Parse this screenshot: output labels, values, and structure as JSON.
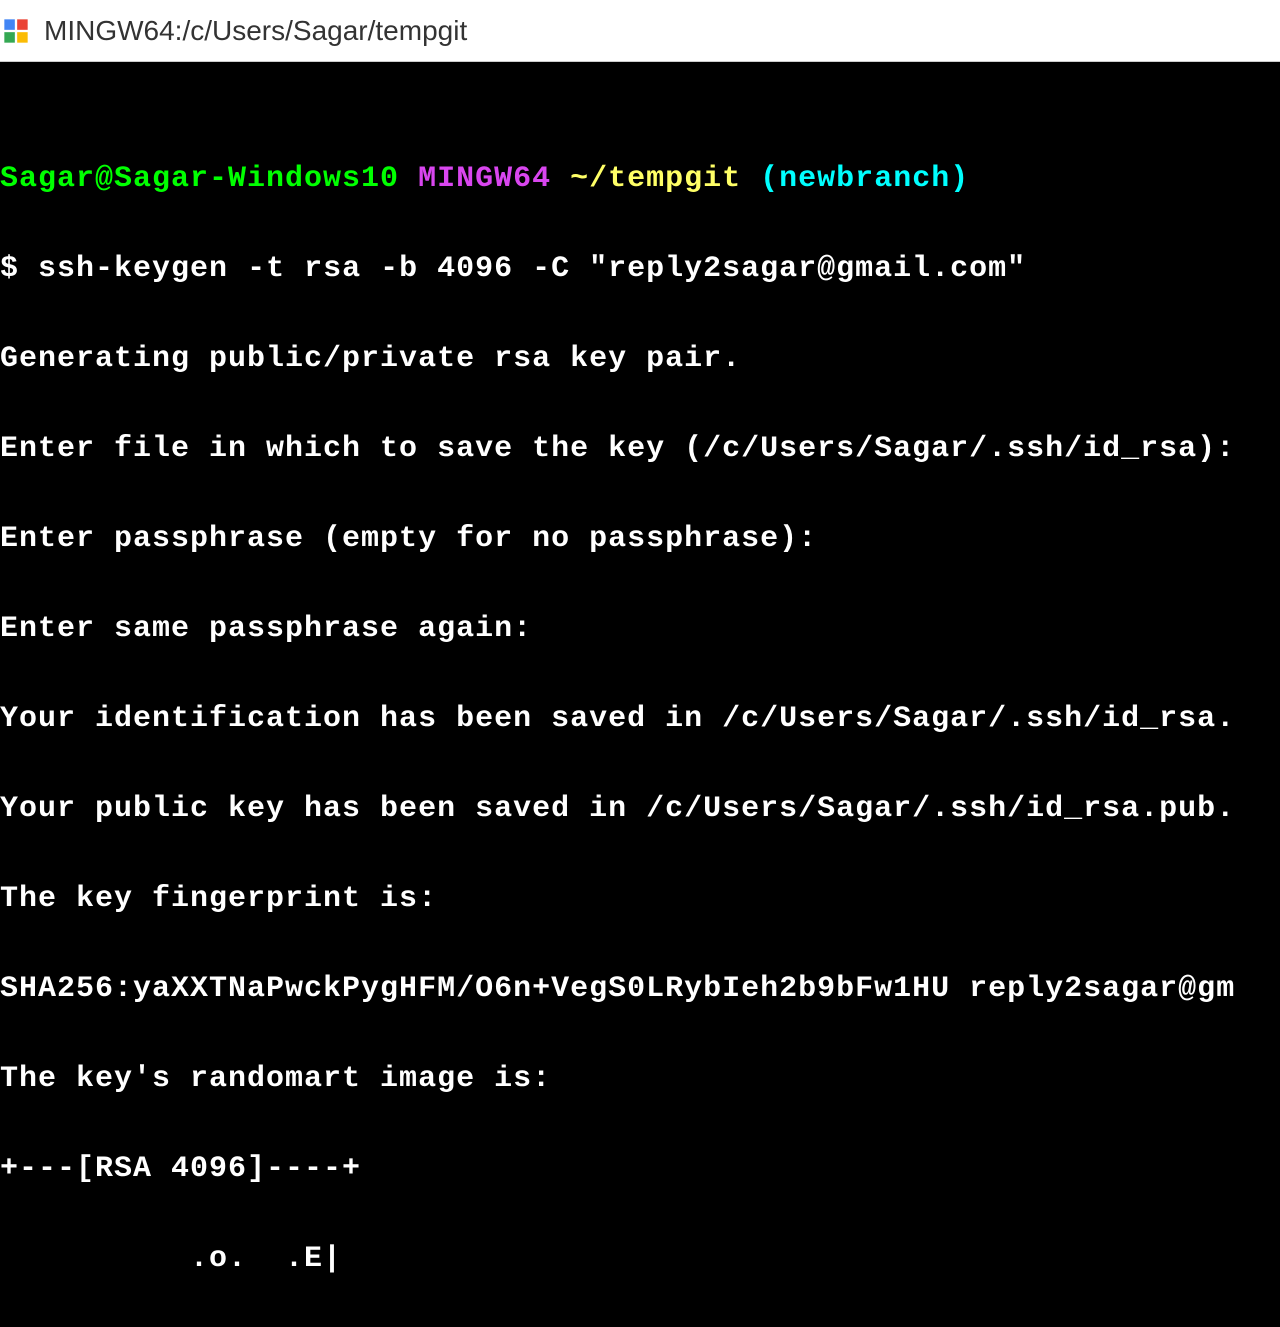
{
  "window": {
    "title": "MINGW64:/c/Users/Sagar/tempgit"
  },
  "prompt": {
    "user_host": "Sagar@Sagar-Windows10",
    "env": "MINGW64",
    "path": "~/tempgit",
    "branch": "(newbranch)"
  },
  "command": {
    "symbol": "$",
    "text": "ssh-keygen -t rsa -b 4096 -C \"reply2sagar@gmail.com\""
  },
  "output": {
    "line1": "Generating public/private rsa key pair.",
    "line2": "Enter file in which to save the key (/c/Users/Sagar/.ssh/id_rsa):",
    "line3": "Enter passphrase (empty for no passphrase):",
    "line4": "Enter same passphrase again:",
    "line5": "Your identification has been saved in /c/Users/Sagar/.ssh/id_rsa.",
    "line6": "Your public key has been saved in /c/Users/Sagar/.ssh/id_rsa.pub.",
    "line7": "The key fingerprint is:",
    "line8": "SHA256:yaXXTNaPwckPygHFM/O6n+VegS0LRybIeh2b9bFw1HU reply2sagar@gm",
    "line9": "The key's randomart image is:",
    "line10": "+---[RSA 4096]----+",
    "line11": "          .o.  .E|"
  }
}
